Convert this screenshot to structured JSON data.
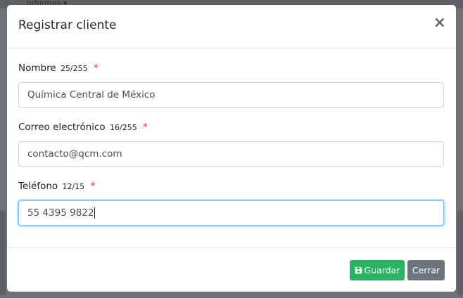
{
  "background": {
    "menu_items": [
      "",
      "Informes ▾"
    ]
  },
  "modal": {
    "title": "Registrar cliente",
    "close_symbol": "×",
    "fields": [
      {
        "label": "Nombre",
        "count": "25/255",
        "required": "*",
        "value": "Química Central de México"
      },
      {
        "label": "Correo electrónico",
        "count": "16/255",
        "required": "*",
        "value": "contacto@qcm.com"
      },
      {
        "label": "Teléfono",
        "count": "12/15",
        "required": "*",
        "value": "55 4395 9822"
      }
    ],
    "buttons": {
      "save_label": "Guardar",
      "cancel_label": "Cerrar"
    }
  },
  "colors": {
    "save": "#28b463",
    "cancel": "#6c757d",
    "required": "#dc3545",
    "focus": "#80bdff"
  }
}
